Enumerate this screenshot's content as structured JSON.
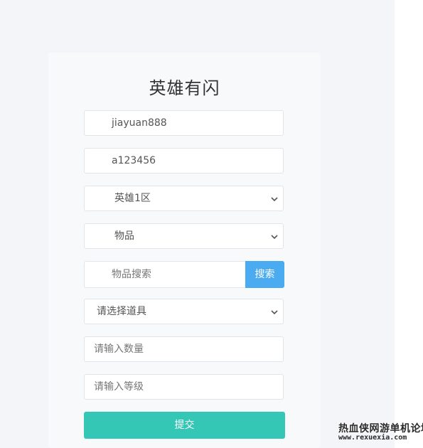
{
  "title": "英雄有闪",
  "fields": {
    "username_value": "jiayuan888",
    "password_value": "a123456",
    "server_select": "英雄1区",
    "category_select": "物品",
    "item_search_placeholder": "物品搜索",
    "prop_select": "请选择道具",
    "quantity_placeholder": "请输入数量",
    "level_placeholder": "请输入等级"
  },
  "buttons": {
    "search_label": "搜索",
    "submit_label": "提交"
  },
  "watermark": {
    "line1": "热血侠网游单机论坛",
    "line2": "www.rexuexia.com"
  },
  "colors": {
    "search_button": "#4aabf0",
    "submit_button": "#35c7b5",
    "card_background": "#f8f9fb"
  },
  "icons": {
    "select_caret": "chevron-down-icon"
  }
}
